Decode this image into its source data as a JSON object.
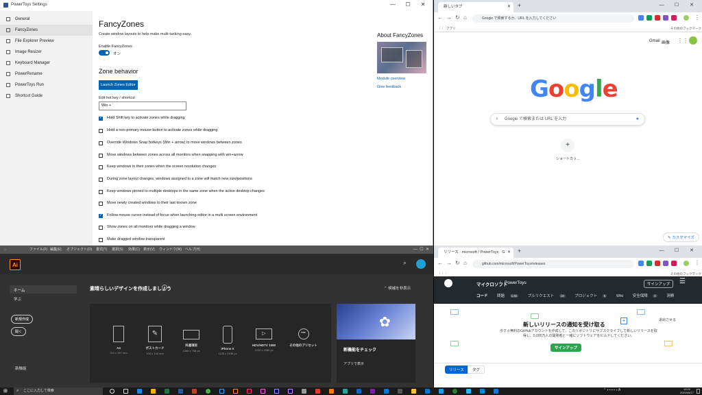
{
  "powertoys": {
    "window_title": "PowerToys Settings",
    "window_controls": [
      "—",
      "☐",
      "✕"
    ],
    "nav": [
      {
        "label": "General"
      },
      {
        "label": "FancyZones"
      },
      {
        "label": "File Explorer Preview"
      },
      {
        "label": "Image Resizer"
      },
      {
        "label": "Keyboard Manager"
      },
      {
        "label": "PowerRename"
      },
      {
        "label": "PowerToys Run"
      },
      {
        "label": "Shortcut Guide"
      }
    ],
    "active_nav": "FancyZones",
    "title": "FancyZones",
    "description": "Create window layouts to help make multi-tasking easy.",
    "enable_label": "Enable FancyZones",
    "toggle_state": "オン",
    "toggle_on": true,
    "zone_behavior_heading": "Zone behavior",
    "launch_button": "Launch Zones Editor",
    "hotkey_label": "Edit hot key / shortcut",
    "hotkey_value": "Win + `",
    "options": [
      {
        "label": "Hold Shift key to activate zones while dragging",
        "checked": true
      },
      {
        "label": "Hold a non-primary mouse button to activate zones while dragging",
        "checked": false
      },
      {
        "label": "Override Windows Snap hotkeys (Win + arrow) to move windows between zones",
        "checked": false
      },
      {
        "label": "Move windows between zones across all monitors when snapping with win+arrow",
        "checked": false
      },
      {
        "label": "Keep windows in their zones when the screen resolution changes",
        "checked": false
      },
      {
        "label": "During zone layout changes, windows assigned to a zone will match new size/positions",
        "checked": false
      },
      {
        "label": "Keep windows pinned to multiple desktops in the same zone when the active desktop changes",
        "checked": false
      },
      {
        "label": "Move newly created windows to their last known zone",
        "checked": false
      },
      {
        "label": "Follow mouse cursor instead of focus when launching editor in a multi screen environment",
        "checked": true
      },
      {
        "label": "Show zones on all monitors while dragging a window",
        "checked": false
      },
      {
        "label": "Make dragged window transparent",
        "checked": false
      }
    ],
    "about_title": "About FancyZones",
    "module_overview": "Module overview",
    "give_feedback": "Give feedback"
  },
  "chrome_top": {
    "tab_title": "新しいタブ",
    "address_placeholder": "Google で検索するか、URL を入力してください",
    "bookmarks_label": "アプリ",
    "other_bookmarks": "その他のブックマーク",
    "gmail": "Gmail",
    "images": "画像",
    "logo_letters": [
      "G",
      "o",
      "o",
      "g",
      "l",
      "e"
    ],
    "logo_colors": [
      "#4285f4",
      "#ea4335",
      "#fbbc05",
      "#4285f4",
      "#34a853",
      "#ea4335"
    ],
    "search_placeholder": "Google で検索または URL を入力",
    "shortcut_plus": "+",
    "shortcut_label": "ショートカッ...",
    "customize_label": "✎ カスタマイズ"
  },
  "illustrator": {
    "menu": [
      "ファイル(F)",
      "編集(E)",
      "オブジェクト(O)",
      "書式(T)",
      "選択(S)",
      "効果(C)",
      "表示(V)",
      "ウィンドウ(W)",
      "ヘルプ(H)"
    ],
    "logo": "Ai",
    "left_nav": [
      "ホーム",
      "学ぶ"
    ],
    "new_button": "新規作成",
    "open_button": "開く",
    "bottom_left": "新機能",
    "heading": "素晴らしいデザインを作成しましょう",
    "hide_suggestions": "候補を非表示",
    "presets": [
      {
        "label": "A4",
        "sub": "210 x 297 mm"
      },
      {
        "label": "ポストカード",
        "sub": "100 x 148 mm"
      },
      {
        "label": "共通項目",
        "sub": "1366 x 768 px"
      },
      {
        "label": "iPhone X",
        "sub": "1125 x 2436 px"
      },
      {
        "label": "HDV/HDTV 1080",
        "sub": "1920 x 1080 px"
      },
      {
        "label": "その他のプリセット",
        "sub": ""
      }
    ],
    "new_features_title": "新機能をチェック",
    "new_features_link": "アプリで表示"
  },
  "chrome_bottom": {
    "tab_title": "リリース · microsoft / PowerToys · G",
    "url": "github.com/microsoft/PowerToys/releases",
    "other_bookmarks": "その他のブックマーク",
    "repo_owner": "マイクロソフト",
    "repo_name": "PowerToys",
    "signup_header": "サインアップ",
    "tabs": [
      {
        "label": "コード",
        "count": ""
      },
      {
        "label": "問題",
        "count": "1,6k"
      },
      {
        "label": "プルリクエスト",
        "count": "19"
      },
      {
        "label": "プロジェクト",
        "count": "5"
      },
      {
        "label": "Wiki",
        "count": ""
      },
      {
        "label": "安全保障",
        "count": "0"
      },
      {
        "label": "洞察",
        "count": ""
      }
    ],
    "banner_title": "新しいリリースの通知を受け取る",
    "banner_text": "今すぐ無料のGitHubアカウントを作成して、このリポジトリにサブスクライブして新しいリリースを取得し、5,000万人の開発者と一緒にソフトウェアをビルドしてください。",
    "signup_button": "サインアップ",
    "dismiss": "退出させる",
    "release_tab": "リリース",
    "tag_tab": "タグ"
  },
  "taskbar": {
    "search_placeholder": "ここに入力して検索",
    "time": "19:20",
    "date": "2020/06/17"
  }
}
